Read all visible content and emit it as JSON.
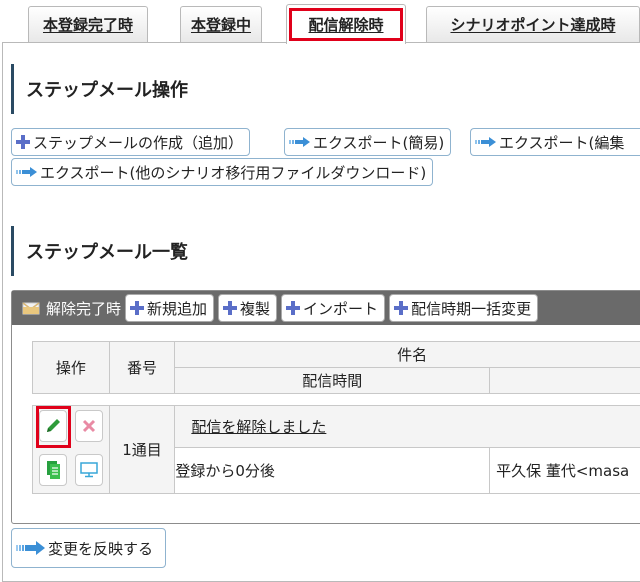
{
  "tabs": [
    {
      "label": "本登録完了時",
      "active": false
    },
    {
      "label": "本登録中",
      "active": false
    },
    {
      "label": "配信解除時",
      "active": true
    },
    {
      "label": "シナリオポイント達成時",
      "active": false
    }
  ],
  "ops_section": {
    "title": "ステップメール操作",
    "buttons": [
      {
        "label": "ステップメールの作成（追加）",
        "icon": "plus-icon"
      },
      {
        "label": "エクスポート(簡易)",
        "icon": "arrow-icon"
      },
      {
        "label": "エクスポート(編集",
        "icon": "arrow-icon"
      },
      {
        "label": "エクスポート(他のシナリオ移行用ファイルダウンロード)",
        "icon": "arrow-icon"
      }
    ]
  },
  "list_section": {
    "title": "ステップメール一覧",
    "group": {
      "title": "解除完了時",
      "buttons": [
        {
          "label": "新規追加",
          "icon": "plus-icon"
        },
        {
          "label": "複製",
          "icon": "plus-icon"
        },
        {
          "label": "インポート",
          "icon": "plus-icon"
        },
        {
          "label": "配信時期一括変更",
          "icon": "plus-icon"
        }
      ]
    },
    "table": {
      "headers": {
        "ops": "操作",
        "number": "番号",
        "subject": "件名",
        "timing": "配信時間"
      },
      "rows": [
        {
          "number": "1通目",
          "subject": "配信を解除しました",
          "timing": "登録から0分後",
          "sender": "平久保 董代<masa"
        }
      ]
    }
  },
  "apply_button": {
    "label": "変更を反映する"
  },
  "colors": {
    "accent_red": "#e0001a",
    "header_gray": "#6a6a6a",
    "plus_blue": "#5a6ec8",
    "button_border": "#8fb3cf"
  }
}
